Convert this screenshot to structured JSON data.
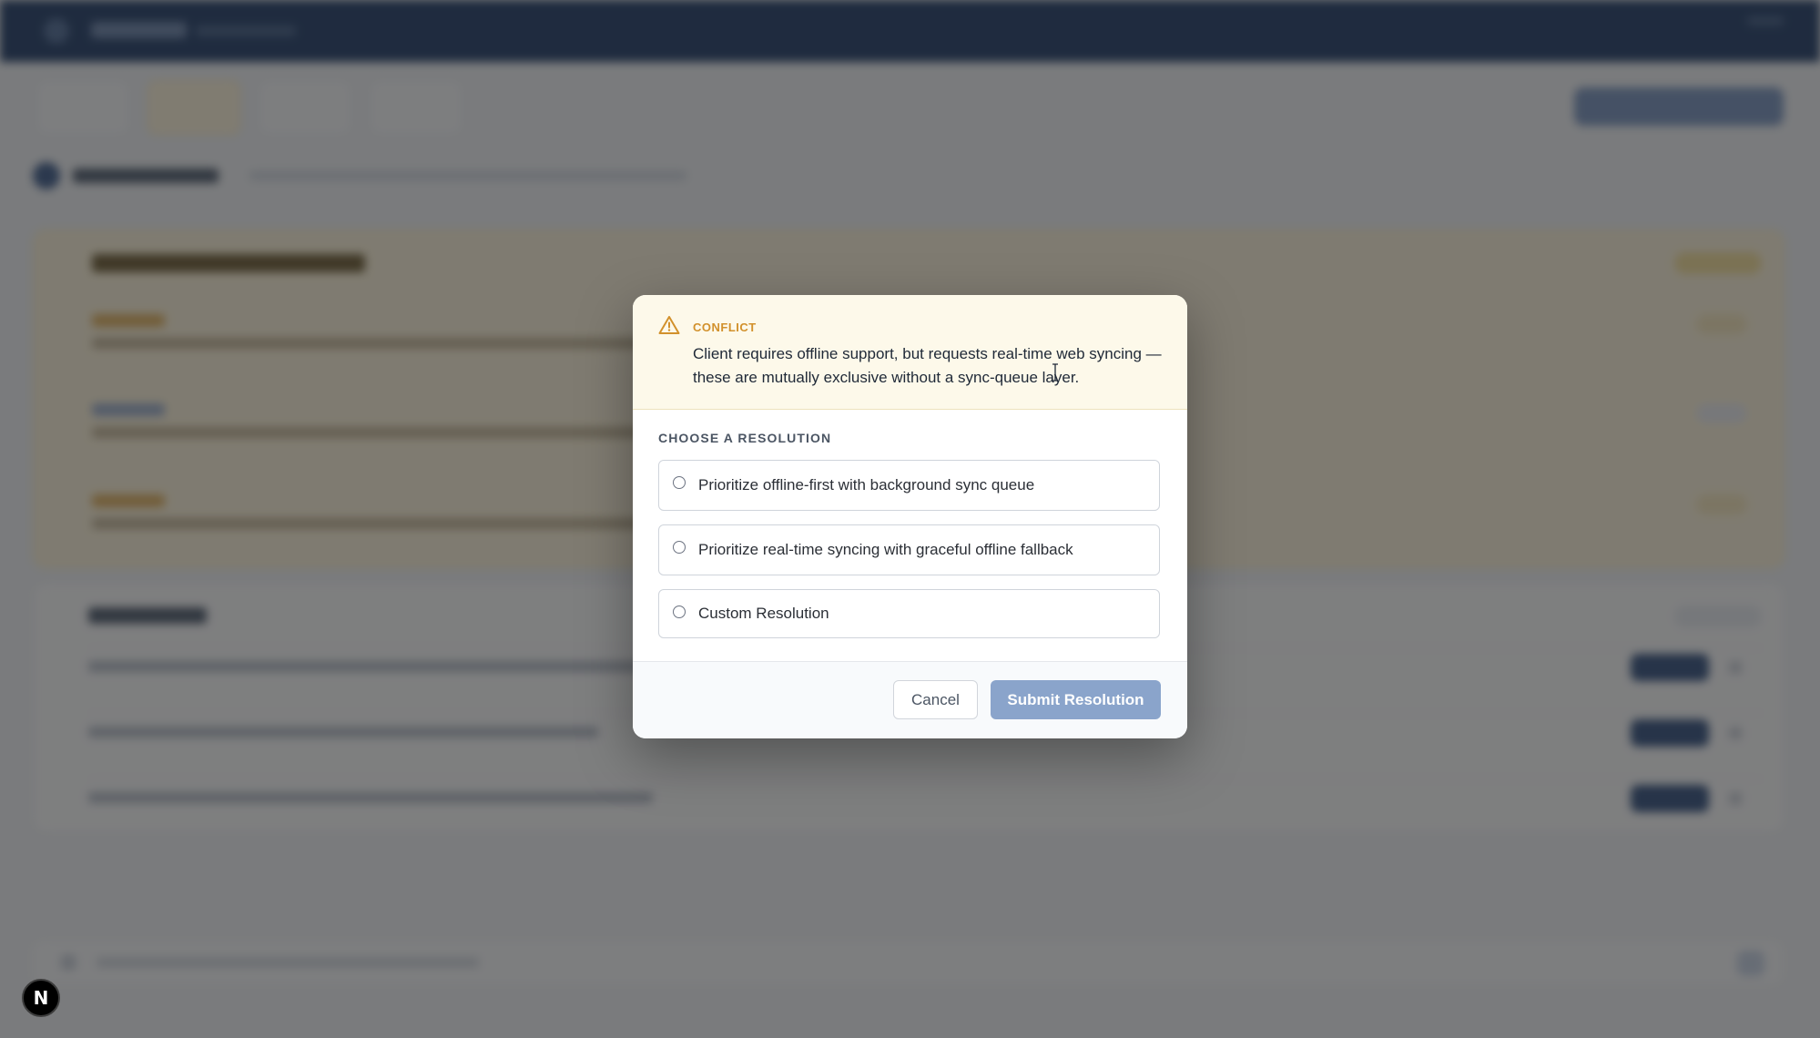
{
  "modal": {
    "conflict": {
      "label": "CONFLICT",
      "icon": "warning-triangle-icon",
      "icon_color": "#d2912c",
      "background": "#fdf9ea",
      "text": "Client requires offline support, but requests real-time web syncing — these are mutually exclusive without a sync-queue layer."
    },
    "section_label": "CHOOSE A RESOLUTION",
    "options": [
      {
        "label": "Prioritize offline-first with background sync queue",
        "selected": false
      },
      {
        "label": "Prioritize real-time syncing with graceful offline fallback",
        "selected": false
      },
      {
        "label": "Custom Resolution",
        "selected": false
      }
    ],
    "cancel_label": "Cancel",
    "submit_label": "Submit Resolution",
    "submit_color": "#8aa4cb"
  },
  "overlay_badge": {
    "label": "N",
    "icon": "nextjs-badge-icon"
  },
  "colors": {
    "topbar": "#0b2a5a",
    "accent": "#1e3f73",
    "warning": "#d2912c"
  }
}
